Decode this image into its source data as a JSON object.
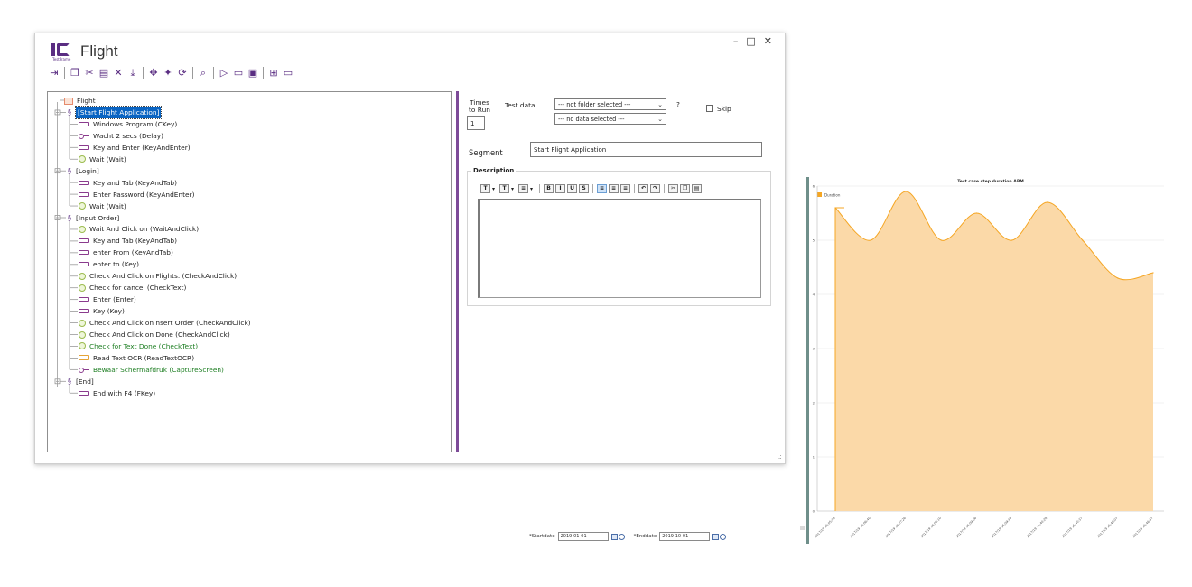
{
  "window": {
    "title": "Flight",
    "logo_caption": "TestFrame",
    "controls": {
      "minimize": "–",
      "maximize": "□",
      "close": "✕"
    }
  },
  "toolbar": [
    {
      "icon": "exit-icon",
      "glyph": "⇥"
    },
    {
      "sep": true
    },
    {
      "icon": "copy-icon",
      "glyph": "❐"
    },
    {
      "icon": "cut-icon",
      "glyph": "✂"
    },
    {
      "icon": "paste-icon",
      "glyph": "▤"
    },
    {
      "icon": "delete-icon",
      "glyph": "✕"
    },
    {
      "icon": "import-icon",
      "glyph": "⤓"
    },
    {
      "sep": true
    },
    {
      "icon": "move-icon",
      "glyph": "✥"
    },
    {
      "icon": "expand-icon",
      "glyph": "✦"
    },
    {
      "icon": "refresh-icon",
      "glyph": "⟳"
    },
    {
      "sep": true
    },
    {
      "icon": "search-icon",
      "glyph": "⌕"
    },
    {
      "sep": true
    },
    {
      "icon": "run-icon",
      "glyph": "▷"
    },
    {
      "icon": "record-icon",
      "glyph": "▭"
    },
    {
      "icon": "play-icon",
      "glyph": "▣"
    },
    {
      "sep": true
    },
    {
      "icon": "tree-icon",
      "glyph": "⊞"
    },
    {
      "icon": "window-icon",
      "glyph": "▭"
    }
  ],
  "tree": {
    "root": "Flight",
    "segments": [
      {
        "label": "[Start Flight Application]",
        "selected": true,
        "steps": [
          {
            "label": "Windows Program (CKey)",
            "type": "key"
          },
          {
            "label": "Wacht 2 secs (Delay)",
            "type": "delay"
          },
          {
            "label": "Key and Enter (KeyAndEnter)",
            "type": "key"
          },
          {
            "label": "Wait  (Wait)",
            "type": "wait"
          }
        ]
      },
      {
        "label": "[Login]",
        "steps": [
          {
            "label": "Key and Tab (KeyAndTab)",
            "type": "key"
          },
          {
            "label": "Enter Password (KeyAndEnter)",
            "type": "key"
          },
          {
            "label": "Wait  (Wait)",
            "type": "wait"
          }
        ]
      },
      {
        "label": "[Input Order]",
        "steps": [
          {
            "label": "Wait And Click on  (WaitAndClick)",
            "type": "wait"
          },
          {
            "label": "Key and Tab (KeyAndTab)",
            "type": "key"
          },
          {
            "label": "enter From (KeyAndTab)",
            "type": "key"
          },
          {
            "label": "enter to (Key)",
            "type": "key"
          },
          {
            "label": "Check And Click on Flights. (CheckAndClick)",
            "type": "wait"
          },
          {
            "label": "Check for cancel (CheckText)",
            "type": "wait"
          },
          {
            "label": "Enter (Enter)",
            "type": "key"
          },
          {
            "label": "Key (Key)",
            "type": "key"
          },
          {
            "label": "Check And Click on nsert Order (CheckAndClick)",
            "type": "wait"
          },
          {
            "label": "Check And Click on Done (CheckAndClick)",
            "type": "wait"
          },
          {
            "label": "Check for Text Done (CheckText)",
            "type": "wait",
            "green": true
          },
          {
            "label": "Read Text OCR (ReadTextOCR)",
            "type": "ocr"
          },
          {
            "label": "Bewaar Schermafdruk (CaptureScreen)",
            "type": "delay",
            "green": true
          }
        ]
      },
      {
        "label": "[End]",
        "steps": [
          {
            "label": "End with F4 (FKey)",
            "type": "key"
          }
        ]
      }
    ]
  },
  "details": {
    "times_to_run_label": "Times\nto Run",
    "times_to_run_value": "1",
    "test_data_label": "Test data",
    "folder_select": "--- not folder selected ---",
    "data_select": "--- no data selected ---",
    "help_label": "?",
    "skip_label": "Skip",
    "segment_label": "Segment",
    "segment_value": "Start Flight Application",
    "description_label": "Description",
    "rt_buttons": [
      {
        "icon": "text-style-icon",
        "glyph": "T",
        "caret": true
      },
      {
        "icon": "font-size-icon",
        "glyph": "T",
        "caret": true
      },
      {
        "icon": "color-icon",
        "glyph": "≡",
        "caret": true
      },
      {
        "sep": true
      },
      {
        "icon": "bold-icon",
        "glyph": "B"
      },
      {
        "icon": "italic-icon",
        "glyph": "I"
      },
      {
        "icon": "underline-icon",
        "glyph": "U"
      },
      {
        "icon": "strike-icon",
        "glyph": "S"
      },
      {
        "sep": true
      },
      {
        "icon": "align-left-icon",
        "glyph": "≡",
        "active": true
      },
      {
        "icon": "align-center-icon",
        "glyph": "≡"
      },
      {
        "icon": "align-right-icon",
        "glyph": "≡"
      },
      {
        "sep": true
      },
      {
        "icon": "undo-icon",
        "glyph": "↶"
      },
      {
        "icon": "redo-icon",
        "glyph": "↷"
      },
      {
        "sep": true
      },
      {
        "icon": "cut-icon",
        "glyph": "✂"
      },
      {
        "icon": "copy-icon",
        "glyph": "❐"
      },
      {
        "icon": "paste-icon",
        "glyph": "▤"
      }
    ]
  },
  "chart_data": {
    "type": "area",
    "title": "Test case step duration APM",
    "legend": [
      "Duration"
    ],
    "legend_position": "top-left",
    "grid": true,
    "x": [
      "2017/19 15:05:09",
      "2017/19 15:06:40",
      "2017/19 15:07:26",
      "2017/19 15:08:10",
      "2017/19 15:09:06",
      "2017/19 15:09:40",
      "2017/19 15:40:28",
      "2017/19 15:40:37",
      "2017/19 15:46:07",
      "2017/19 15:46:37"
    ],
    "series": [
      {
        "name": "Duration",
        "values": [
          5.6,
          5.0,
          5.9,
          5.0,
          5.5,
          5.0,
          5.7,
          5.0,
          4.3,
          4.4
        ]
      }
    ],
    "ylim": [
      0,
      6
    ],
    "yticks": [
      "0",
      "1",
      "2",
      "3",
      "4",
      "5",
      "6"
    ],
    "color": "#f5a623",
    "fill": "#fbd9a8"
  },
  "filters": {
    "startdate_label": "*Startdate",
    "startdate_value": "2019-01-01",
    "enddate_label": "*Enddate",
    "enddate_value": "2019-10-01"
  }
}
